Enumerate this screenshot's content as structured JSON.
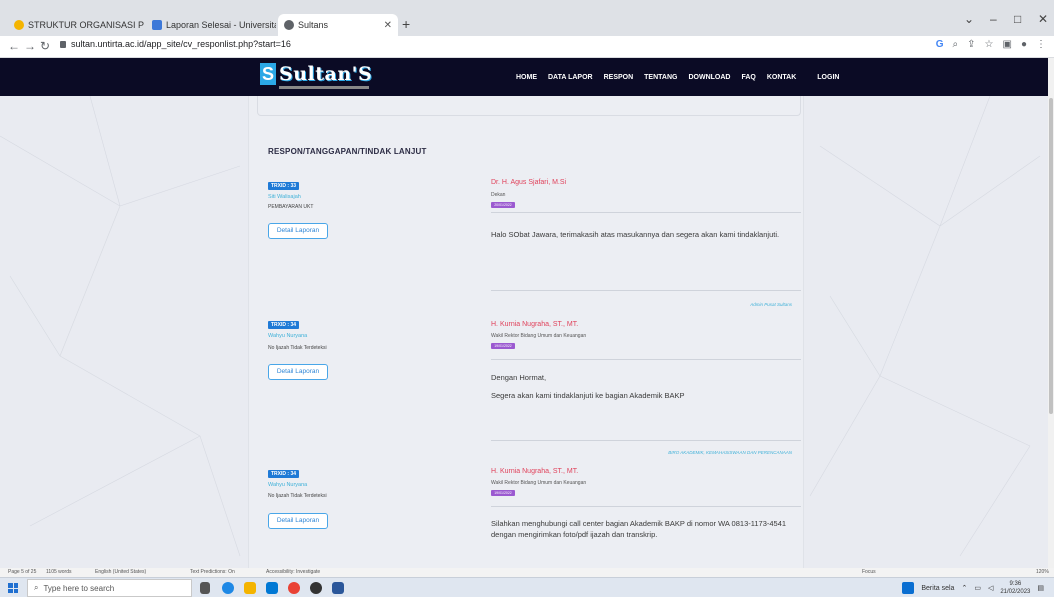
{
  "browser": {
    "tabs": [
      {
        "title": "STRUKTUR ORGANISASI PPID U",
        "active": false
      },
      {
        "title": "Laporan Selesai - Universitas Sul",
        "active": false
      },
      {
        "title": "Sultans",
        "active": true
      }
    ],
    "url": "sultan.untirta.ac.id/app_site/cv_responlist.php?start=16",
    "window_controls": [
      "⌄",
      "–",
      "□",
      "✕"
    ]
  },
  "site": {
    "logo_text": "Sultan'S",
    "menu": [
      "HOME",
      "DATA LAPOR",
      "RESPON",
      "TENTANG",
      "DOWNLOAD",
      "FAQ",
      "KONTAK",
      "LOGIN"
    ]
  },
  "main": {
    "section_title": "RESPON/TANGGAPAN/TINDAK LANJUT",
    "responses": [
      {
        "txid": "TRXID : 33",
        "reporter": "Siti Walisajah",
        "subject": "PEMBAYARAN UKT",
        "detail_label": "Detail Laporan",
        "officer": "Dr. H. Agus Sjafari, M.Si",
        "position": "Dekan",
        "date": "20/01/2022",
        "message": "Halo SObat Jawara, terimakasih atas masukannya dan segera akan kami tindaklanjuti.",
        "signature": "Admin Pusat Sultans"
      },
      {
        "txid": "TRXID : 34",
        "reporter": "Wahyu Nuryana",
        "subject": "No Ijazah Tidak Terdeteksi",
        "detail_label": "Detail Laporan",
        "officer": "H. Kurnia Nugraha, ST., MT.",
        "position": "Wakil Rektor Bidang Umum dan Keuangan",
        "date": "19/01/2022",
        "message": "Dengan Hormat,",
        "message2": "Segera akan kami tindaklanjuti ke bagian Akademik BAKP",
        "signature": "BIRO AKADEMIK, KEMAHASISWAAN DAN PERENCANAAN"
      },
      {
        "txid": "TRXID : 34",
        "reporter": "Wahyu Nuryana",
        "subject": "No Ijazah Tidak Terdeteksi",
        "detail_label": "Detail Laporan",
        "officer": "H. Kurnia Nugraha, ST., MT.",
        "position": "Wakil Rektor Bidang Umum dan Keuangan",
        "date": "19/01/2022",
        "message": "Silahkan menghubungi call center bagian Akademik BAKP di nomor WA 0813-1173-4541 dengan mengirimkan foto/pdf ijazah dan transkrip."
      }
    ]
  },
  "word_status": {
    "page": "Page 5 of 25",
    "words": "1105 words",
    "language": "English (United States)",
    "predictions": "Text Predictions: On",
    "accessibility": "Accessibility: Investigate",
    "focus": "Focus",
    "zoom": "120%"
  },
  "taskbar": {
    "search_placeholder": "Type here to search",
    "news": "Berita sela",
    "time": "9:36",
    "date": "21/02/2023"
  },
  "colors": {
    "header_bg": "#0b0b25",
    "accent_blue": "#1f7ad6",
    "officer_red": "#e0425b",
    "date_purple": "#9b59d0"
  }
}
